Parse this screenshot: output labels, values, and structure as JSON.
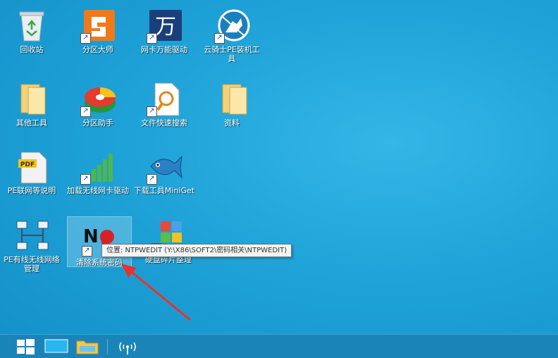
{
  "desktop": {
    "icons": [
      {
        "label": "回收站",
        "icon": "recycle-bin-icon"
      },
      {
        "label": "分区大师",
        "icon": "partition-master-icon"
      },
      {
        "label": "网卡万能驱动",
        "icon": "network-driver-icon"
      },
      {
        "label": "云骑士PE装机工具",
        "icon": "knight-installer-icon"
      },
      {
        "label": "其他工具",
        "icon": "folder-icon"
      },
      {
        "label": "分区助手",
        "icon": "partition-assistant-icon"
      },
      {
        "label": "文件快速搜索",
        "icon": "file-search-icon"
      },
      {
        "label": "资料",
        "icon": "folder-icon"
      },
      {
        "label": "PE联网等说明",
        "icon": "pdf-icon"
      },
      {
        "label": "加载无线网卡驱动",
        "icon": "wireless-signal-icon"
      },
      {
        "label": "下载工具MiniGet",
        "icon": "miniget-fish-icon"
      },
      {
        "label": "PE有线无线网络管理",
        "icon": "network-topology-icon"
      },
      {
        "label": "清除系统密码",
        "icon": "ntpwedit-icon"
      },
      {
        "label": "硬盘碎片整理",
        "icon": "defrag-icon"
      }
    ],
    "tooltip": "位置: NTPWEDIT (Y:\\X86\\SOFT2\\密码相关\\NTPWEDIT)"
  },
  "taskbar": {
    "items": [
      "start-button",
      "desktop-icon",
      "file-explorer-icon",
      "network-status-icon"
    ]
  },
  "colors": {
    "accent": "#1fa3d8",
    "taskbar": "#1a84b8",
    "arrow": "#e8322a"
  }
}
